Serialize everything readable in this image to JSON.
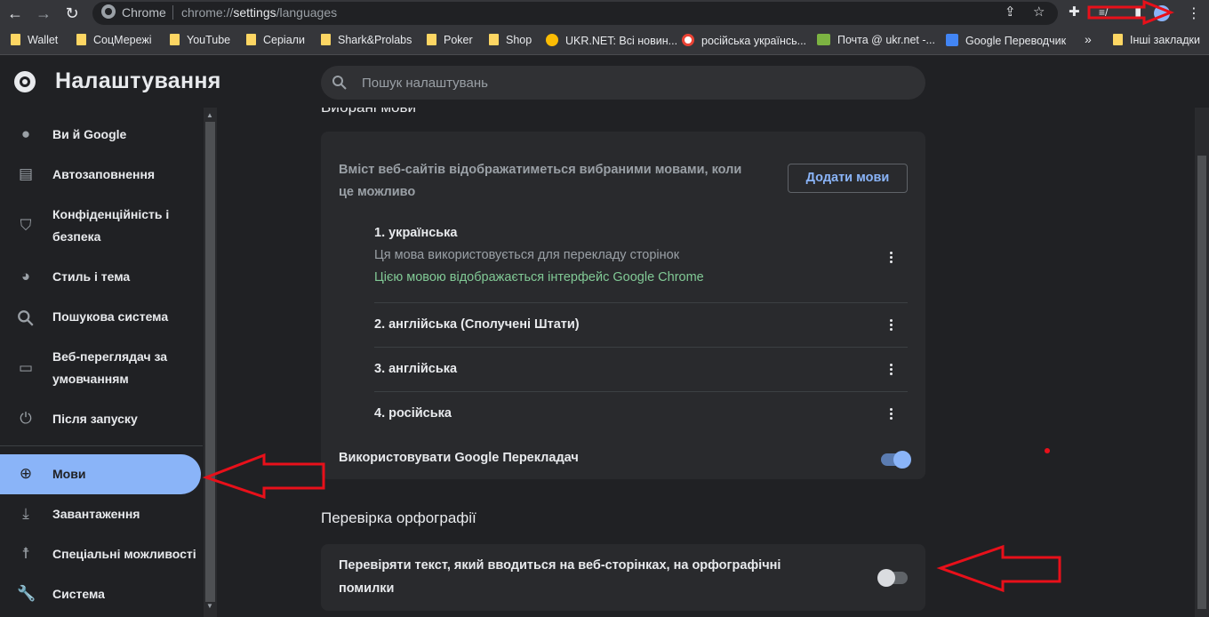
{
  "browser": {
    "site_chip": "Chrome",
    "url_prefix": "chrome://",
    "url_host": "settings",
    "url_path": "/languages"
  },
  "bookmarks": [
    {
      "label": "Wallet",
      "icon": "folder-icon"
    },
    {
      "label": "СоцМережі",
      "icon": "folder-icon"
    },
    {
      "label": "YouTube",
      "icon": "folder-icon"
    },
    {
      "label": "Серіали",
      "icon": "folder-icon"
    },
    {
      "label": "Shark&Prolabs",
      "icon": "folder-icon"
    },
    {
      "label": "Poker",
      "icon": "folder-icon"
    },
    {
      "label": "Shop",
      "icon": "folder-icon"
    },
    {
      "label": "UKR.NET: Всі новин...",
      "icon": "ukrnet-icon"
    },
    {
      "label": "російська українсь...",
      "icon": "google-icon"
    },
    {
      "label": "Почта @ ukr.net -...",
      "icon": "mail-icon"
    },
    {
      "label": "Google Переводчик",
      "icon": "translate-icon"
    },
    {
      "label": "»",
      "icon": "chevron-double-icon"
    },
    {
      "label": "Інші закладки",
      "icon": "folder-icon"
    }
  ],
  "header": {
    "title": "Налаштування",
    "search_placeholder": "Пошук налаштувань"
  },
  "sidebar": {
    "items": [
      {
        "label": "Ви й Google",
        "icon": "person-icon"
      },
      {
        "label": "Автозаповнення",
        "icon": "clipboard-icon"
      },
      {
        "label": "Конфіденційність і",
        "label2": "безпека",
        "icon": "shield-icon"
      },
      {
        "label": "Стиль і тема",
        "icon": "palette-icon"
      },
      {
        "label": "Пошукова система",
        "icon": "search-icon"
      },
      {
        "label": "Веб-переглядач за",
        "label2": "умовчанням",
        "icon": "browser-icon"
      },
      {
        "label": "Після запуску",
        "icon": "power-icon"
      },
      {
        "label": "Мови",
        "icon": "globe-icon",
        "active": true
      },
      {
        "label": "Завантаження",
        "icon": "download-icon"
      },
      {
        "label": "Спеціальні можливості",
        "icon": "accessibility-icon"
      },
      {
        "label": "Система",
        "icon": "wrench-icon"
      }
    ]
  },
  "languages_section": {
    "title_partial": "Вибрані мови",
    "description_line1": "Вміст веб-сайтів відображатиметься вибраними мовами, коли",
    "description_line2": "це можливо",
    "add_button": "Додати мови",
    "languages": [
      {
        "name": "1. українська",
        "sub": "Ця мова використовується для перекладу сторінок",
        "ui_note": "Цією мовою відображається інтерфейс Google Chrome"
      },
      {
        "name": "2. англійська (Сполучені Штати)"
      },
      {
        "name": "3. англійська"
      },
      {
        "name": "4. російська"
      }
    ],
    "translate_label": "Використовувати Google Перекладач",
    "translate_enabled": true
  },
  "spellcheck_section": {
    "title": "Перевірка орфографії",
    "text_line1": "Перевіряти текст, який вводиться на веб-сторінках, на орфографічні",
    "text_line2": "помилки",
    "enabled": false
  },
  "colors": {
    "accent": "#8ab4f8",
    "ui_language_note": "#81c995",
    "annotation": "#e8101a"
  }
}
